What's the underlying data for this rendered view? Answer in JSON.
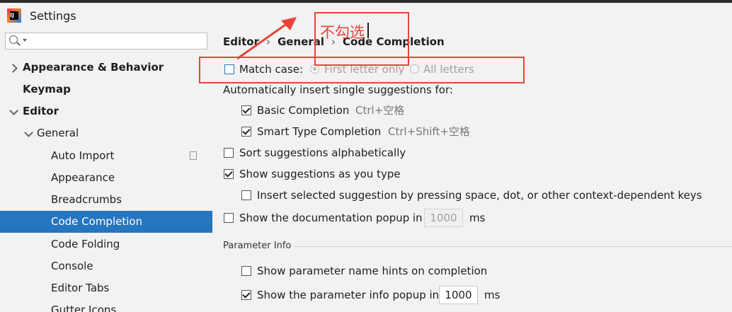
{
  "window": {
    "title": "Settings"
  },
  "search": {
    "placeholder": ""
  },
  "sidebar": {
    "items": [
      {
        "label": "Appearance & Behavior"
      },
      {
        "label": "Keymap"
      },
      {
        "label": "Editor"
      },
      {
        "label": "General"
      },
      {
        "label": "Auto Import"
      },
      {
        "label": "Appearance"
      },
      {
        "label": "Breadcrumbs"
      },
      {
        "label": "Code Completion"
      },
      {
        "label": "Code Folding"
      },
      {
        "label": "Console"
      },
      {
        "label": "Editor Tabs"
      },
      {
        "label": "Gutter Icons"
      }
    ],
    "selected": "Code Completion"
  },
  "breadcrumb": [
    "Editor",
    "General",
    "Code Completion"
  ],
  "breadcrumb_sep": "›",
  "settings": {
    "match_case": {
      "label": "Match case:",
      "checked": false
    },
    "first_letter_only": {
      "label": "First letter only",
      "selected": true,
      "enabled": false
    },
    "all_letters": {
      "label": "All letters",
      "selected": false,
      "enabled": false
    },
    "auto_insert_label": "Automatically insert single suggestions for:",
    "basic_completion": {
      "label": "Basic Completion",
      "shortcut": "Ctrl+空格",
      "checked": true
    },
    "smart_type_completion": {
      "label": "Smart Type Completion",
      "shortcut": "Ctrl+Shift+空格",
      "checked": true
    },
    "sort_alpha": {
      "label": "Sort suggestions alphabetically",
      "checked": false
    },
    "show_as_you_type": {
      "label": "Show suggestions as you type",
      "checked": true
    },
    "insert_selected": {
      "label": "Insert selected suggestion by pressing space, dot, or other context-dependent keys",
      "checked": false
    },
    "doc_popup": {
      "label": "Show the documentation popup in",
      "value": "1000",
      "unit": "ms",
      "checked": false
    },
    "parameter_info_section": "Parameter Info",
    "param_name_hints": {
      "label": "Show parameter name hints on completion",
      "checked": false
    },
    "param_info_popup": {
      "label": "Show the parameter info popup in",
      "value": "1000",
      "unit": "ms",
      "checked": true
    }
  },
  "annotation": {
    "text": "不勾选",
    "color": "#e8443a"
  },
  "colors": {
    "selection": "#2675bf",
    "annotation": "#e8443a"
  }
}
